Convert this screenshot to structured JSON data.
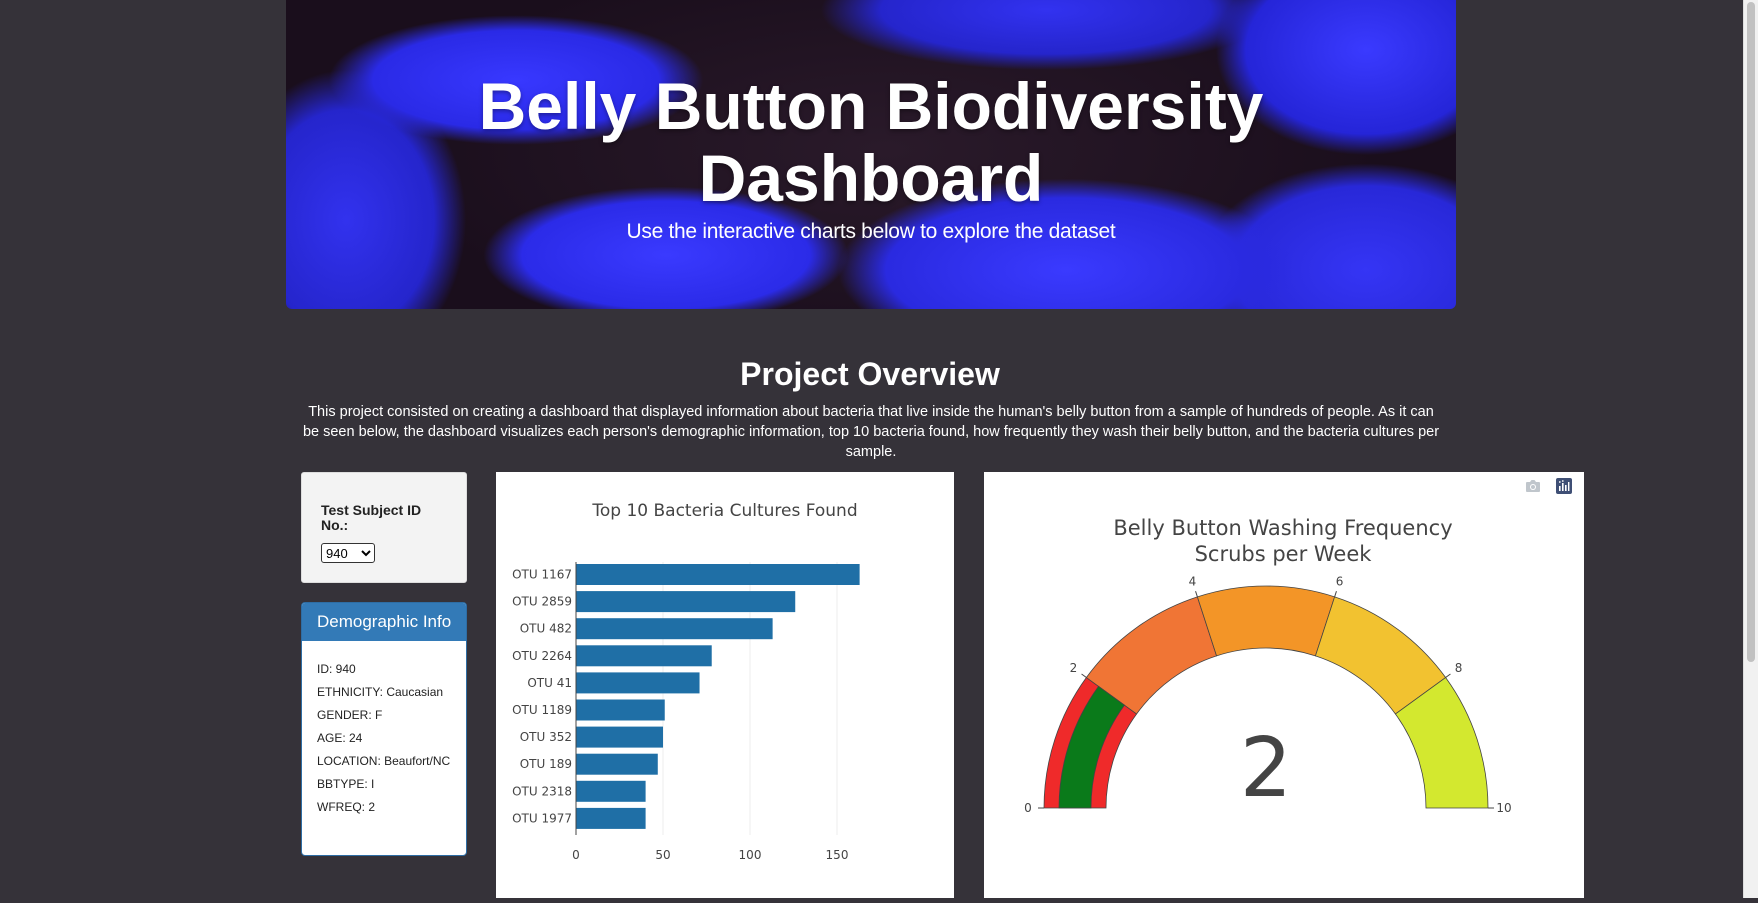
{
  "hero": {
    "title_line1": "Belly Button Biodiversity",
    "title_line2": "Dashboard",
    "subtitle": "Use the interactive charts below to explore the dataset"
  },
  "overview": {
    "title": "Project Overview",
    "text": "This project consisted on creating a dashboard that displayed information about bacteria that live inside the human's belly button from a sample of hundreds of people. As it can be seen below, the dashboard visualizes each person's demographic information, top 10 bacteria found, how frequently they wash their belly button, and the bacteria cultures per sample."
  },
  "selector": {
    "label": "Test Subject ID No.:",
    "selected": "940"
  },
  "demographic": {
    "title": "Demographic Info",
    "rows": [
      "ID: 940",
      "ETHNICITY: Caucasian",
      "GENDER: F",
      "AGE: 24",
      "LOCATION: Beaufort/NC",
      "BBTYPE: I",
      "WFREQ: 2"
    ]
  },
  "modebar": {
    "icons": [
      "camera-icon",
      "plotly-logo-icon"
    ]
  },
  "chart_data": [
    {
      "type": "bar",
      "orientation": "horizontal",
      "title": "Top 10 Bacteria Cultures Found",
      "categories": [
        "OTU 1167",
        "OTU 2859",
        "OTU 482",
        "OTU 2264",
        "OTU 41",
        "OTU 1189",
        "OTU 352",
        "OTU 189",
        "OTU 2318",
        "OTU 1977"
      ],
      "values": [
        163,
        126,
        113,
        78,
        71,
        51,
        50,
        47,
        40,
        40
      ],
      "xlim": [
        0,
        170
      ],
      "xticks": [
        0,
        50,
        100,
        150
      ],
      "bar_color": "#1f6fa6",
      "grid": true
    },
    {
      "type": "gauge",
      "title": "Belly Button Washing Frequency",
      "subtitle": "Scrubs per Week",
      "value": 2,
      "range": [
        0,
        10
      ],
      "ticks": [
        0,
        2,
        4,
        6,
        8,
        10
      ],
      "steps": [
        {
          "range": [
            0,
            2
          ],
          "color": "#ef2a2a"
        },
        {
          "range": [
            2,
            4
          ],
          "color": "#f07535"
        },
        {
          "range": [
            4,
            6
          ],
          "color": "#f39527"
        },
        {
          "range": [
            6,
            8
          ],
          "color": "#f2c230"
        },
        {
          "range": [
            8,
            10
          ],
          "color": "#d3e82f"
        }
      ],
      "bar_color": "#0a7a1a"
    }
  ]
}
